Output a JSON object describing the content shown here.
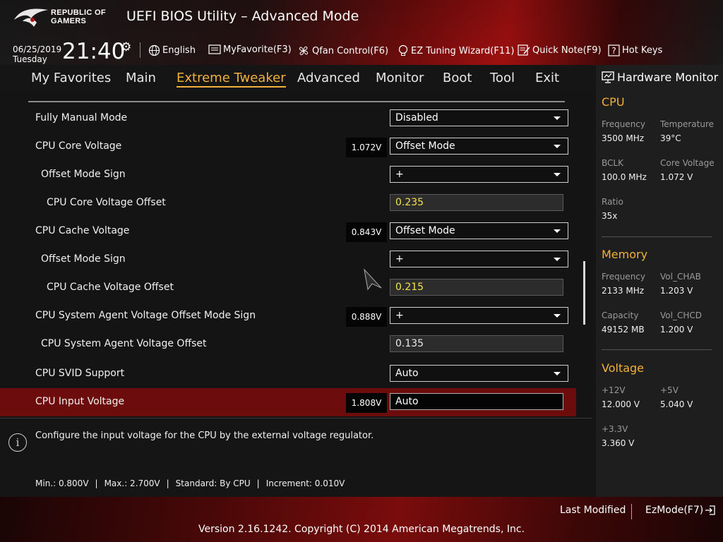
{
  "header": {
    "brand_line1": "REPUBLIC OF",
    "brand_line2": "GAMERS",
    "title": "UEFI BIOS Utility – Advanced Mode",
    "date": "06/25/2019",
    "day": "Tuesday",
    "time": "21:40",
    "toolbar": {
      "language": "English",
      "myfavorite": "MyFavorite(F3)",
      "qfan": "Qfan Control(F6)",
      "ez_tuning": "EZ Tuning Wizard(F11)",
      "quick_note": "Quick Note(F9)",
      "hot_keys": "Hot Keys"
    }
  },
  "nav": {
    "tabs": [
      "My Favorites",
      "Main",
      "Extreme Tweaker",
      "Advanced",
      "Monitor",
      "Boot",
      "Tool",
      "Exit"
    ],
    "active": "Extreme Tweaker"
  },
  "settings": [
    {
      "label": "Fully Manual Mode",
      "control": "select",
      "value": "Disabled"
    },
    {
      "label": "CPU Core Voltage",
      "voltage": "1.072V",
      "control": "select",
      "value": "Offset Mode"
    },
    {
      "label": "Offset Mode Sign",
      "control": "select",
      "value": "+"
    },
    {
      "label": "CPU Core Voltage Offset",
      "control": "input",
      "value": "0.235"
    },
    {
      "label": "CPU Cache Voltage",
      "voltage": "0.843V",
      "control": "select",
      "value": "Offset Mode"
    },
    {
      "label": "Offset Mode Sign",
      "control": "select",
      "value": "+"
    },
    {
      "label": "CPU Cache Voltage Offset",
      "control": "input",
      "value": "0.215"
    },
    {
      "label": "CPU System Agent Voltage Offset Mode Sign",
      "voltage": "0.888V",
      "control": "select",
      "value": "+"
    },
    {
      "label": "CPU System Agent Voltage Offset",
      "control": "input",
      "value": "0.135"
    },
    {
      "label": "CPU SVID Support",
      "control": "select",
      "value": "Auto"
    },
    {
      "label": "CPU Input Voltage",
      "voltage": "1.808V",
      "control": "input",
      "value": "Auto",
      "selected": true
    }
  ],
  "help": {
    "text": "Configure the input voltage for the CPU by the external voltage regulator.",
    "min": "Min.: 0.800V",
    "max": "Max.: 2.700V",
    "standard": "Standard: By CPU",
    "increment": "Increment: 0.010V",
    "separator": "|"
  },
  "hardware_monitor": {
    "title": "Hardware Monitor",
    "cpu": {
      "heading": "CPU",
      "frequency_label": "Frequency",
      "frequency": "3500 MHz",
      "temperature_label": "Temperature",
      "temperature": "39°C",
      "bclk_label": "BCLK",
      "bclk": "100.0 MHz",
      "core_voltage_label": "Core Voltage",
      "core_voltage": "1.072 V",
      "ratio_label": "Ratio",
      "ratio": "35x"
    },
    "memory": {
      "heading": "Memory",
      "frequency_label": "Frequency",
      "frequency": "2133 MHz",
      "vol_chab_label": "Vol_CHAB",
      "vol_chab": "1.203 V",
      "capacity_label": "Capacity",
      "capacity": "49152 MB",
      "vol_chcd_label": "Vol_CHCD",
      "vol_chcd": "1.200 V"
    },
    "voltage": {
      "heading": "Voltage",
      "v12_label": "+12V",
      "v12": "12.000 V",
      "v5_label": "+5V",
      "v5": "5.040 V",
      "v33_label": "+3.3V",
      "v33": "3.360 V"
    }
  },
  "footer": {
    "last_modified": "Last Modified",
    "ezmode": "EzMode(F7)",
    "copyright": "Version 2.16.1242. Copyright (C) 2014 American Megatrends, Inc."
  },
  "colors": {
    "accent": "#f2b13a",
    "highlight_row": "#6d0c0c",
    "offset_value": "#f2e24a"
  }
}
